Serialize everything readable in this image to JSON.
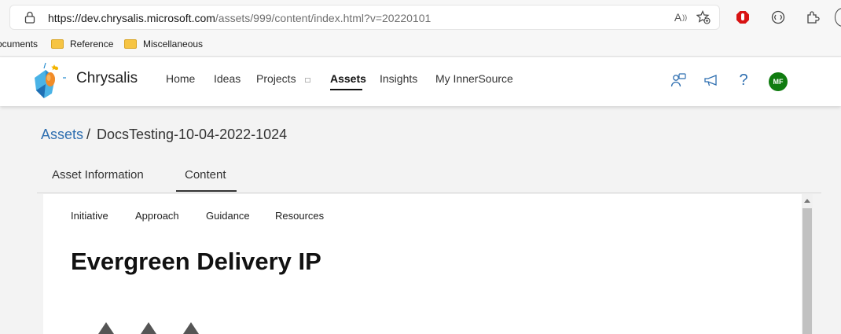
{
  "browser": {
    "url_host": "https://dev.chrysalis.microsoft.com",
    "url_path": "/assets/999/content/index.html?v=20220101",
    "icons": [
      "lock-icon",
      "read-aloud-icon",
      "add-favorite-icon",
      "adblock-icon",
      "extension-icon",
      "puzzle-icon"
    ],
    "read_aloud_label": "A"
  },
  "bookmarks": [
    {
      "label": "ocuments"
    },
    {
      "label": "Reference"
    },
    {
      "label": "Miscellaneous"
    }
  ],
  "app": {
    "brand": "Chrysalis",
    "nav": [
      {
        "label": "Home"
      },
      {
        "label": "Ideas"
      },
      {
        "label": "Projects"
      },
      {
        "label": "Assets"
      },
      {
        "label": "Insights"
      },
      {
        "label": "My InnerSource"
      }
    ],
    "projects_caret": "□",
    "help_glyph": "?",
    "avatar_initials": "MF",
    "accent_color": "#2f6fb0",
    "avatar_color": "#107c10"
  },
  "breadcrumb": {
    "link": "Assets",
    "separator": "/",
    "current": "DocsTesting-10-04-2022-1024"
  },
  "tabs": [
    {
      "label": "Asset Information"
    },
    {
      "label": "Content"
    }
  ],
  "content": {
    "sub_tabs": [
      {
        "label": "Initiative"
      },
      {
        "label": "Approach"
      },
      {
        "label": "Guidance"
      },
      {
        "label": "Resources"
      }
    ],
    "title": "Evergreen Delivery IP"
  }
}
